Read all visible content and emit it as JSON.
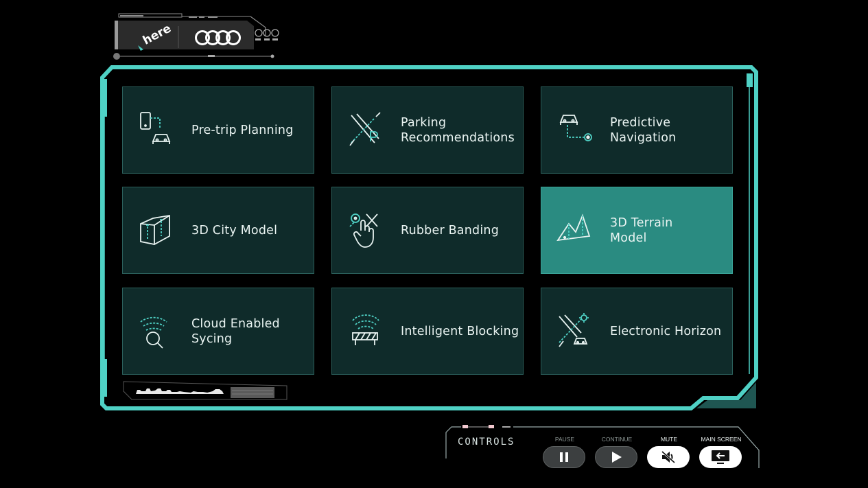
{
  "brand": {
    "logo_left": "here",
    "logo_right_icon": "audi-rings-logo"
  },
  "tiles": [
    {
      "label": "Pre-trip Planning",
      "icon": "phone-car-route-icon",
      "active": false
    },
    {
      "label": "Parking\nRecommendations",
      "icon": "parking-route-icon",
      "active": false
    },
    {
      "label": "Predictive\nNavigation",
      "icon": "car-destination-icon",
      "active": false
    },
    {
      "label": "3D City Model",
      "icon": "city-block-icon",
      "active": false
    },
    {
      "label": "Rubber Banding",
      "icon": "hand-drag-route-icon",
      "active": false
    },
    {
      "label": "3D Terrain\nModel",
      "icon": "mountain-terrain-icon",
      "active": true
    },
    {
      "label": "Cloud Enabled\nSycing",
      "icon": "cloud-search-icon",
      "active": false
    },
    {
      "label": "Intelligent Blocking",
      "icon": "road-block-icon",
      "active": false
    },
    {
      "label": "Electronic Horizon",
      "icon": "route-horizon-icon",
      "active": false
    }
  ],
  "controls": {
    "title": "CONTROLS",
    "buttons": [
      {
        "label": "PAUSE",
        "icon": "pause-icon"
      },
      {
        "label": "CONTINUE",
        "icon": "play-icon"
      },
      {
        "label": "MUTE",
        "icon": "mute-icon"
      },
      {
        "label": "MAIN SCREEN",
        "icon": "main-screen-icon"
      }
    ]
  },
  "colors": {
    "accent": "#4fd1c5",
    "tile_bg": "#0f2b2a",
    "tile_active": "#2a8b81"
  }
}
